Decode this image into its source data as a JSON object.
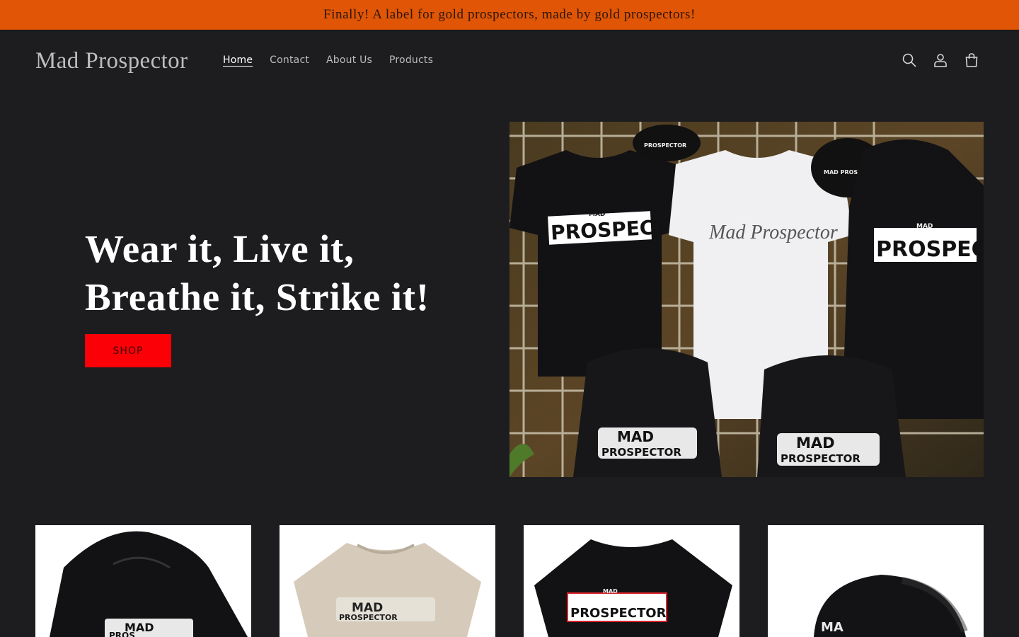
{
  "announcement": {
    "text": "Finally! A label for gold prospectors, made by gold prospectors!"
  },
  "header": {
    "logo": "Mad Prospector",
    "nav": [
      {
        "label": "Home",
        "active": true
      },
      {
        "label": "Contact",
        "active": false
      },
      {
        "label": "About Us",
        "active": false
      },
      {
        "label": "Products",
        "active": false
      }
    ],
    "icons": [
      "search-icon",
      "account-icon",
      "cart-icon"
    ]
  },
  "hero": {
    "heading_line1": "Wear it, Live it,",
    "heading_line2": "Breathe it, Strike it!",
    "button_label": "SHOP",
    "image": {
      "tshirt_left_text": "PROSPECTOR",
      "tshirt_left_small": "MAD",
      "tshirt_center_text": "Mad Prospector",
      "hoodie_right_text": "PROSPECTOR",
      "hoodie_right_small": "MAD",
      "bottom_left_top": "MAD",
      "bottom_left_bottom": "PROSPECTOR",
      "bottom_right_top": "MAD",
      "bottom_right_bottom": "PROSPECTOR",
      "cap_text": "MAD PROSPECTOR",
      "cap_left_text": "PROSPECTOR"
    }
  },
  "products": {
    "cards": [
      {
        "kind": "hoodie",
        "print_top": "MAD",
        "print_bottom": "PROS"
      },
      {
        "kind": "tshirt-tan",
        "print_top": "MAD",
        "print_bottom": "PROSPECTOR"
      },
      {
        "kind": "tshirt-black",
        "print_top": "MAD",
        "print_bottom": "PROSPECTOR"
      },
      {
        "kind": "cap",
        "print_top": "MA"
      }
    ]
  },
  "colors": {
    "background": "#1d1d20",
    "announcement": "#e05506",
    "button": "#fb0007",
    "print_red": "#d9212a"
  }
}
